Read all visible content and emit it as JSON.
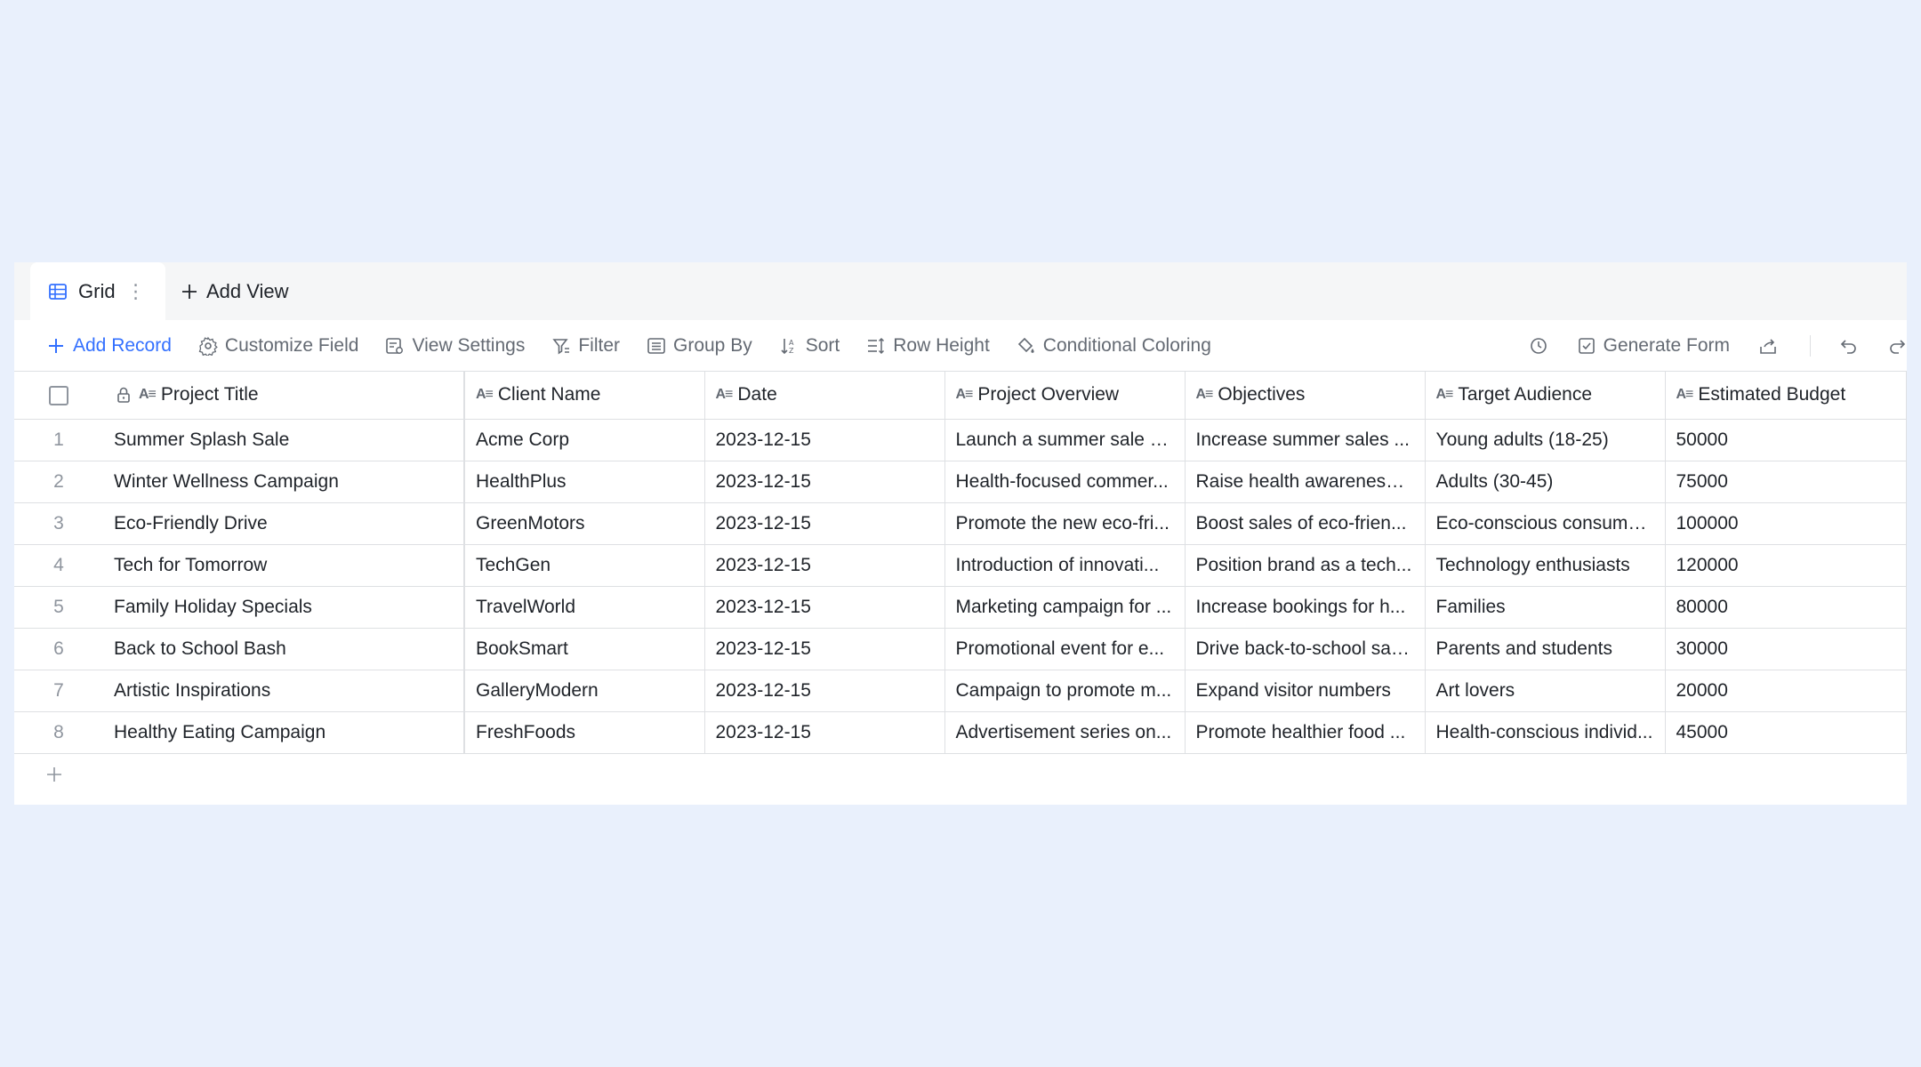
{
  "tabs": {
    "grid_label": "Grid",
    "add_view_label": "Add View"
  },
  "toolbar": {
    "add_record": "Add Record",
    "customize_field": "Customize Field",
    "view_settings": "View Settings",
    "filter": "Filter",
    "group_by": "Group By",
    "sort": "Sort",
    "row_height": "Row Height",
    "conditional_coloring": "Conditional Coloring",
    "generate_form": "Generate Form"
  },
  "colors": {
    "accent": "#3370ff",
    "background": "#e9f0fc"
  },
  "table": {
    "columns": [
      "Project Title",
      "Client Name",
      "Date",
      "Project Overview",
      "Objectives",
      "Target Audience",
      "Estimated Budget"
    ],
    "rows": [
      {
        "n": "1",
        "cells": [
          "Summer Splash Sale",
          "Acme Corp",
          "2023-12-15",
          "Launch a summer sale s...",
          "Increase summer sales ...",
          "Young adults (18-25)",
          "50000"
        ]
      },
      {
        "n": "2",
        "cells": [
          "Winter Wellness Campaign",
          "HealthPlus",
          "2023-12-15",
          "Health-focused commer...",
          "Raise health awareness ...",
          "Adults (30-45)",
          "75000"
        ]
      },
      {
        "n": "3",
        "cells": [
          "Eco-Friendly Drive",
          "GreenMotors",
          "2023-12-15",
          "Promote the new eco-fri...",
          "Boost sales of eco-frien...",
          "Eco-conscious consumers",
          "100000"
        ]
      },
      {
        "n": "4",
        "cells": [
          "Tech for Tomorrow",
          "TechGen",
          "2023-12-15",
          "Introduction of innovati...",
          "Position brand as a tech...",
          "Technology enthusiasts",
          "120000"
        ]
      },
      {
        "n": "5",
        "cells": [
          "Family Holiday Specials",
          "TravelWorld",
          "2023-12-15",
          "Marketing campaign for ...",
          "Increase bookings for h...",
          "Families",
          "80000"
        ]
      },
      {
        "n": "6",
        "cells": [
          "Back to School Bash",
          "BookSmart",
          "2023-12-15",
          "Promotional event for e...",
          "Drive back-to-school sales",
          "Parents and students",
          "30000"
        ]
      },
      {
        "n": "7",
        "cells": [
          "Artistic Inspirations",
          "GalleryModern",
          "2023-12-15",
          "Campaign to promote m...",
          "Expand visitor numbers",
          "Art lovers",
          "20000"
        ]
      },
      {
        "n": "8",
        "cells": [
          "Healthy Eating Campaign",
          "FreshFoods",
          "2023-12-15",
          "Advertisement series on...",
          "Promote healthier food ...",
          "Health-conscious individ...",
          "45000"
        ]
      }
    ]
  }
}
